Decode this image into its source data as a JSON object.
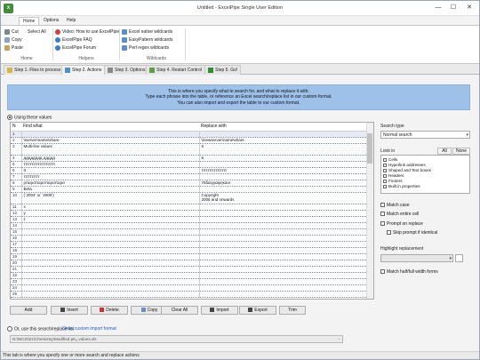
{
  "window": {
    "title": "Untitled - ExcelPipe Single User Edition",
    "minimize": "—",
    "maximize": "☐",
    "close": "✕",
    "app_icon": "x"
  },
  "menu": {
    "tabs": [
      "Home",
      "Options",
      "Help"
    ]
  },
  "ribbon": {
    "home": {
      "cut": "Cut",
      "select_all": "Select All",
      "copy": "Copy",
      "paste": "Paste",
      "group": "Home"
    },
    "helpers": {
      "video": "Video: How to use ExcelPipe",
      "faq": "ExcelPipe FAQ",
      "forum": "ExcelPipe Forum",
      "group": "Helpers"
    },
    "wildcards": {
      "native": "Excel native wildcards",
      "easypattern": "EasyPattern wildcards",
      "regex": "Perl regex wildcards",
      "group": "Wildcards"
    }
  },
  "steps": [
    {
      "label": "Step 1. Files to process"
    },
    {
      "label": "Step 2. Actions"
    },
    {
      "label": "Step 3. Options"
    },
    {
      "label": "Step 4. Restart Control"
    },
    {
      "label": "Step 5. Go!"
    }
  ],
  "banner": {
    "line1": "This is where you specify what to search for, and what to replace it with.",
    "line2": "Type each phrase into the table, or reference an Excel search/replace list in our custom format.",
    "line3": "You can also import and export the table to our custom format."
  },
  "use_values": "Using these values",
  "table": {
    "headers": [
      "N",
      "Find what",
      "Replace with"
    ],
    "rows": [
      {
        "n": "1",
        "find": "",
        "replace": ""
      },
      {
        "n": "2",
        "find": "\\\\server\\name\\share",
        "replace": "\\\\newserver\\name\\share"
      },
      {
        "n": "3",
        "find": "Multi-line values",
        "replace": "5"
      },
      {
        "n": "4",
        "find": "дддддддд ддддд",
        "replace": "6"
      },
      {
        "n": "5",
        "find": "ττττττττττττττττττττ",
        "replace": ""
      },
      {
        "n": "6",
        "find": "tt",
        "replace": "ττττττττττττττττ"
      },
      {
        "n": "7",
        "find": "ττττττττττ",
        "replace": ""
      },
      {
        "n": "8",
        "find": "ρπαρσπαρσπαρσπαρσ",
        "replace": "76διαγραφηκανε"
      },
      {
        "n": "9",
        "find": "Beta",
        "replace": ""
      },
      {
        "n": "10",
        "find": "(`2004' or `2005')",
        "replace": "Copyright",
        "replace2": "2006 and onwards"
      },
      {
        "n": "11",
        "find": "x",
        "replace": ""
      },
      {
        "n": "12",
        "find": "y",
        "replace": ""
      },
      {
        "n": "13",
        "find": "z",
        "replace": ""
      },
      {
        "n": "14",
        "find": "",
        "replace": ""
      },
      {
        "n": "15",
        "find": "",
        "replace": ""
      },
      {
        "n": "16",
        "find": "",
        "replace": ""
      },
      {
        "n": "17",
        "find": "",
        "replace": ""
      },
      {
        "n": "18",
        "find": "",
        "replace": ""
      },
      {
        "n": "19",
        "find": "",
        "replace": ""
      },
      {
        "n": "20",
        "find": "",
        "replace": ""
      },
      {
        "n": "21",
        "find": "",
        "replace": ""
      },
      {
        "n": "22",
        "find": "",
        "replace": ""
      },
      {
        "n": "23",
        "find": "",
        "replace": ""
      },
      {
        "n": "24",
        "find": "",
        "replace": ""
      },
      {
        "n": "25",
        "find": "",
        "replace": ""
      }
    ]
  },
  "right_panel": {
    "search_type_label": "Search type",
    "search_type_value": "Normal search",
    "look_in_label": "Look in",
    "all_btn": "All",
    "none_btn": "None",
    "look_in_items": [
      "Cells",
      "Hyperlink addresses",
      "Shaped and Text boxes",
      "Headers",
      "Footers",
      "Built in properties"
    ],
    "match_case": "Match case",
    "match_entire": "Match entire cell",
    "prompt_replace": "Prompt on replace",
    "skip_prompt": "Skip prompt if identical",
    "highlight_label": "Highlight replacement",
    "halfwidth": "Match half/full width forms"
  },
  "buttons": {
    "add": "Add",
    "insert": "Insert",
    "delete": "Delete",
    "copy": "Copy",
    "clear_all": "Clear All",
    "import": "Import",
    "export": "Export",
    "trim": "Trim"
  },
  "or_use": "Or, use this search/replace list",
  "custom_link": "Show custom import format",
  "file_path": "N:\\WC2021\\Chemistry\\Modified pKₐ values.xls",
  "file_btn": "...",
  "status": "This tab is where you specify one or more search and replace actions",
  "colors": {
    "banner": "#9ec1ea",
    "accent": "#3f8f3a",
    "selected_row": "#e6eaf7"
  }
}
